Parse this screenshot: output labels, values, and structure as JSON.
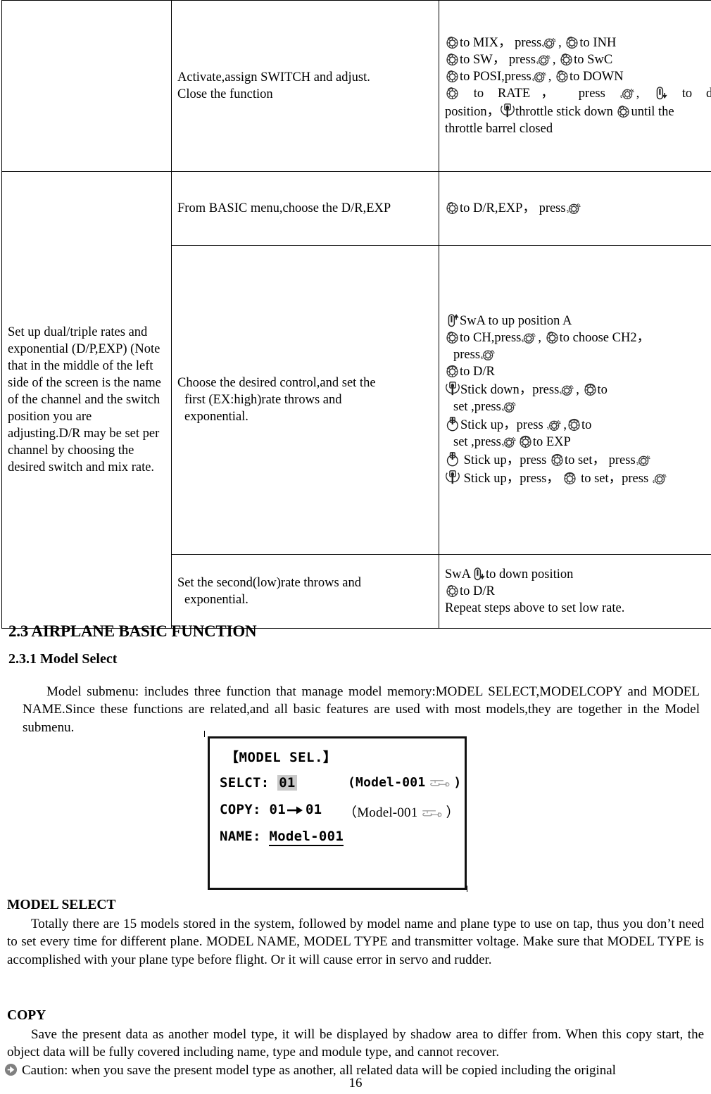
{
  "table": {
    "rows": [
      {
        "desc": [
          "Activate,assign SWITCH and adjust.",
          "Close the function"
        ],
        "steps": [
          "to MIX，press , to INH",
          "to SW，press , to SwC",
          "to POSI,press , to DOWN",
          "to RATE， press ， to down",
          "position， throttle stick down until the",
          "throttle barrel closed"
        ],
        "step_words": {
          "l1_a": "to MIX，",
          "l1_b": "press",
          "l1_c": ",",
          "l1_d": "to INH",
          "l2_a": "to SW，",
          "l2_b": "press",
          "l2_c": ",",
          "l2_d": "to SwC",
          "l3_a": "to POSI,press",
          "l3_c": ",",
          "l3_d": "to DOWN",
          "l4_a": "to RATE，",
          "l4_b": "press",
          "l4_c": ",",
          "l4_d": "to down",
          "l5_a": "position，",
          "l5_b": "throttle stick down",
          "l5_c": "until the",
          "l6_a": "throttle barrel closed"
        }
      },
      {
        "left_label": "Set up dual/triple rates and exponential (D/P,EXP) (Note that in the middle of the left side of the screen is the name of the channel and the switch position you are adjusting.D/R may be set per channel by choosing the desired switch and mix rate.",
        "desc": [
          "From BASIC menu,choose the D/R,EXP"
        ],
        "step_words": {
          "a": "to D/R,EXP，",
          "b": "press"
        }
      },
      {
        "desc": [
          "Choose the desired control,and set the",
          "first (EX:high)rate throws and",
          "exponential."
        ],
        "step_words": {
          "l1_a": "SwA to up position A",
          "l2_a": "to CH,press",
          "l2_b": ",",
          "l2_c": "to choose CH2，",
          "l3_a": "press",
          "l4_a": "to D/R",
          "l5_a": "Stick down，press",
          "l5_b": ",",
          "l5_c": "to",
          "l6_a": "set ,press",
          "l7_a": "Stick up，press",
          "l7_b": ",",
          "l7_c": "to",
          "l8_a": "set ,press",
          "l8_b": "to EXP",
          "l9_a": "Stick up，press",
          "l9_b": "to set，",
          "l9_c": "press",
          "l10_a": "Stick up，press，",
          "l10_b": "to set，press"
        }
      },
      {
        "desc": [
          "Set the second(low)rate throws and",
          "exponential."
        ],
        "step_words": {
          "l1_a": "SwA",
          "l1_b": "to down position",
          "l2_a": "to D/R",
          "l3_a": "Repeat steps above to set low rate."
        }
      }
    ],
    "left_label_text": "Set up dual/triple rates and exponential (D/P,EXP) (Note that in the middle of the left side of the screen is the name of the channel and the switch position you are adjusting.D/R may be set per channel by choosing the desired switch and mix rate."
  },
  "headings": {
    "section": "2.3 AIRPLANE BASIC FUNCTION",
    "subsection": "2.3.1 Model Select"
  },
  "intro_paragraph": "Model submenu: includes three function that manage model memory:MODEL SELECT,MODELCOPY and MODEL NAME.Since these functions are related,and all basic features are used with most models,they are together in the Model submenu.",
  "lcd": {
    "title": "【MODEL SEL.】",
    "select_label": "SELCT:",
    "select_value": "01",
    "select_paren_open": "(Model-001",
    "select_paren_close": ")",
    "copy_label": "COPY:",
    "copy_from": "01",
    "copy_to": "01",
    "copy_paren_open": "（Model-001",
    "copy_paren_close": "）",
    "name_label": "NAME:",
    "name_value": "Model-001"
  },
  "sections": {
    "model_select_label": "MODEL SELECT",
    "model_select_body": "Totally there are 15 models stored in the system, followed by model name and plane type to use on tap, thus you don’t need to set every time for different plane. MODEL NAME, MODEL TYPE and transmitter voltage. Make sure that MODEL TYPE is accomplished with your plane type before flight. Or it will cause error in servo and rudder.",
    "copy_label": "COPY",
    "copy_body": "Save the present data as another model type, it will be displayed by shadow area to differ from. When this copy start, the object data will be fully covered including name, type and module type, and cannot recover.",
    "caution_text": "Caution: when you save the present model type as another, all related data will be copied including the original"
  },
  "page_number": "16",
  "icons": {
    "dial_rotate": "rotary-dial-icon",
    "dial_press": "dial-press-icon",
    "switch_up": "toggle-switch-up-icon",
    "switch_down": "toggle-switch-down-icon",
    "stick_down": "stick-down-icon",
    "stick_up": "stick-up-icon",
    "throttle_stick": "throttle-stick-icon",
    "helicopter": "helicopter-icon",
    "caution_arrow": "caution-arrow-icon"
  }
}
